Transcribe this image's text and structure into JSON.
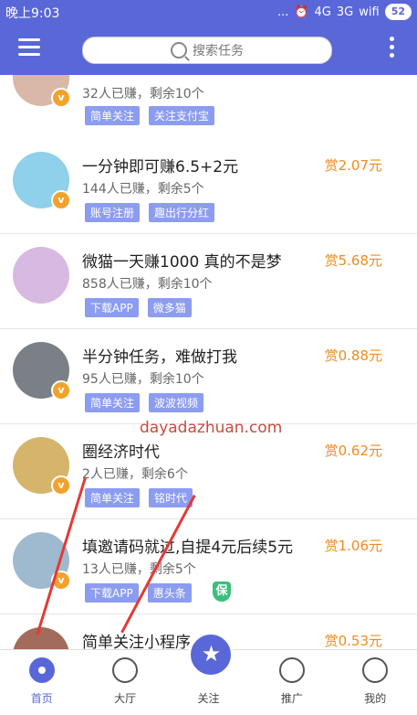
{
  "status": {
    "time": "晚上9:03",
    "icons": [
      "... ",
      "⏰",
      "4G",
      "3G",
      "wifi"
    ],
    "battery": "52"
  },
  "header": {
    "search_placeholder": "搜索任务"
  },
  "items": [
    {
      "title": "",
      "meta": "32人已赚，剩余10个",
      "tags": [
        "简单关注",
        "关注支付宝"
      ],
      "reward": ""
    },
    {
      "title": "一分钟即可赚6.5+2元",
      "meta": "144人已赚，剩余5个",
      "tags": [
        "账号注册",
        "趣出行分红"
      ],
      "reward": "赏2.07元"
    },
    {
      "title": "微猫一天赚1000 真的不是梦",
      "meta": "858人已赚，剩余10个",
      "tags": [
        "下载APP",
        "微多猫"
      ],
      "reward": "赏5.68元"
    },
    {
      "title": "半分钟任务，难做打我",
      "meta": "95人已赚，剩余10个",
      "tags": [
        "简单关注",
        "波波视频"
      ],
      "reward": "赏0.88元"
    },
    {
      "title": "圈经济时代",
      "meta": "2人已赚，剩余6个",
      "tags": [
        "简单关注",
        "铭时代"
      ],
      "reward": "赏0.62元"
    },
    {
      "title": "填邀请码就过,自提4元后续5元",
      "meta": "13人已赚，剩余5个",
      "tags": [
        "下载APP",
        "惠头条"
      ],
      "reward": "赏1.06元",
      "shield": "保"
    },
    {
      "title": "简单关注小程序",
      "meta": "",
      "tags": [],
      "reward": "赏0.53元"
    }
  ],
  "watermark": "dayadazhuan.com",
  "bottom_nav": [
    {
      "label": "首页"
    },
    {
      "label": "大厅"
    },
    {
      "label": "关注"
    },
    {
      "label": "推广"
    },
    {
      "label": "我的"
    }
  ]
}
